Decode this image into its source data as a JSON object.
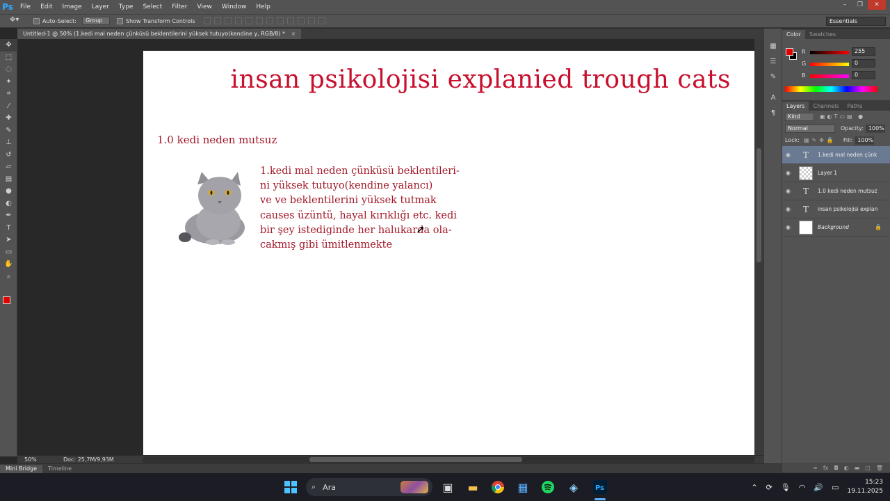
{
  "app": {
    "logo": "Ps",
    "menu": [
      "File",
      "Edit",
      "Image",
      "Layer",
      "Type",
      "Select",
      "Filter",
      "View",
      "Window",
      "Help"
    ],
    "window_controls": [
      "–",
      "❐",
      "✕"
    ]
  },
  "options_bar": {
    "auto_select_label": "Auto-Select:",
    "auto_select_value": "Group",
    "transform_label": "Show Transform Controls",
    "workspace": "Essentials"
  },
  "document_tab": {
    "title": "Untitled-1 @ 50% (1.kedi mal neden çünküsü beklentilerini yüksek tutuyo(kendine y, RGB/8) *",
    "close": "×"
  },
  "canvas": {
    "title": "insan psikolojisi explanied trough cats",
    "heading": "1.0 kedi neden mutsuz",
    "body_lines": [
      "1.kedi mal neden çünküsü beklentileri-",
      "ni yüksek tutuyo(kendine yalancı)",
      " ve ve beklentilerini yüksek tutmak",
      "causes üzüntü, hayal kırıklığı etc. kedi",
      "bir şey istediginde her halukarda ola-",
      "cakmış gibi ümitlenmekte"
    ]
  },
  "status": {
    "zoom": "50%",
    "doc_size": "Doc: 25,7M/9,93M"
  },
  "mini_bridge": {
    "tabs": [
      "Mini Bridge",
      "Timeline"
    ]
  },
  "color_panel": {
    "tabs": [
      "Color",
      "Swatches"
    ],
    "channels": [
      {
        "letter": "R",
        "value": "255"
      },
      {
        "letter": "G",
        "value": "0"
      },
      {
        "letter": "B",
        "value": "0"
      }
    ],
    "accent": "#e00000"
  },
  "layers_panel": {
    "tabs": [
      "Layers",
      "Channels",
      "Paths"
    ],
    "filter_kind": "Kind",
    "blend_mode": "Normal",
    "opacity_label": "Opacity:",
    "opacity_value": "100%",
    "lock_label": "Lock:",
    "fill_label": "Fill:",
    "fill_value": "100%",
    "layers": [
      {
        "name": "1.kedi mal neden çünk...",
        "type": "text",
        "selected": true
      },
      {
        "name": "Layer 1",
        "type": "pixel",
        "selected": false
      },
      {
        "name": "1.0 kedi neden mutsuz",
        "type": "text",
        "selected": false
      },
      {
        "name": "insan psikolojisi explani...",
        "type": "text",
        "selected": false
      },
      {
        "name": "Background",
        "type": "background",
        "selected": false
      }
    ]
  },
  "taskbar": {
    "search_label": "Ara",
    "time": "15:23",
    "date": "19.11.2025"
  }
}
